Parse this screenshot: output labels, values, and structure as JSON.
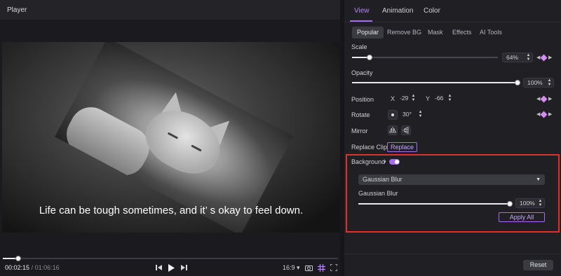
{
  "player": {
    "title": "Player",
    "subtitle": "Life can be tough sometimes, and it’ s okay to feel down.",
    "current_time": "00:02:15",
    "separator": "/",
    "total_time": "01:06:16",
    "playback_progress": 0.045,
    "aspect_ratio": "16:9",
    "aspect_caret": "▾"
  },
  "tabs": [
    "View",
    "Animation",
    "Color"
  ],
  "subtabs": [
    "Popular",
    "Remove BG",
    "Mask",
    "Effects",
    "AI Tools"
  ],
  "scale": {
    "label": "Scale",
    "value": "64%",
    "fraction": 0.12
  },
  "opacity": {
    "label": "Opacity",
    "value": "100%",
    "fraction": 1.0
  },
  "position": {
    "label": "Position",
    "x_label": "X",
    "x_value": "-29",
    "y_label": "Y",
    "y_value": "-66"
  },
  "rotate": {
    "label": "Rotate",
    "value": "30°"
  },
  "mirror": {
    "label": "Mirror"
  },
  "replace_clip": {
    "label": "Replace Clip",
    "button": "Replace"
  },
  "background": {
    "label": "Background",
    "caret": "▾",
    "enabled": true,
    "dropdown_value": "Gaussian Blur",
    "blur_label": "Gaussian Blur",
    "blur_value": "100%",
    "blur_fraction": 1.0,
    "apply_all": "Apply All"
  },
  "footer": {
    "reset": "Reset"
  },
  "colors": {
    "accent": "#a56cf0",
    "keyframe": "#d68cf2",
    "highlight": "#e0302a"
  }
}
